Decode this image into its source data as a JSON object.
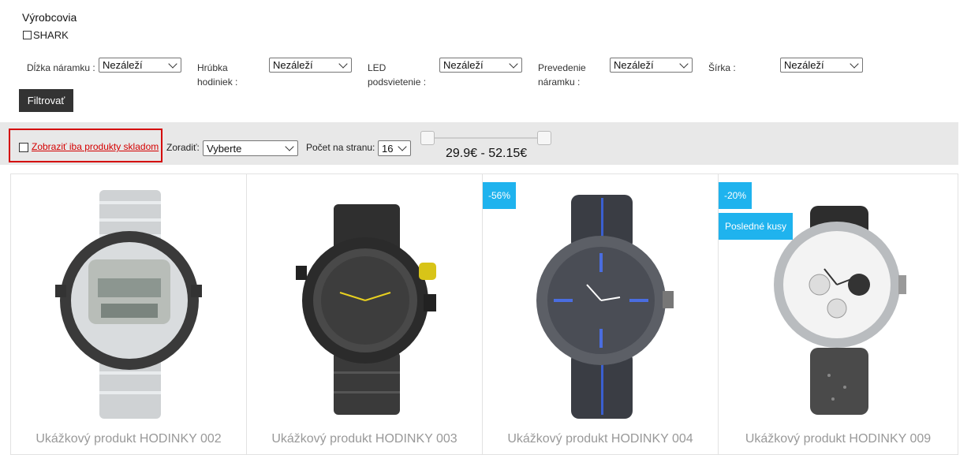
{
  "filters": {
    "brand_title": "Výrobcovia",
    "brand_option": "SHARK",
    "fields": [
      {
        "label_lines": [
          "Dĺžka náramku :"
        ],
        "value": "Nezáleží"
      },
      {
        "label_lines": [
          "Hrúbka",
          "hodiniek :"
        ],
        "value": "Nezáleží"
      },
      {
        "label_lines": [
          "LED",
          "podsvietenie :"
        ],
        "value": "Nezáleží"
      },
      {
        "label_lines": [
          "Prevedenie",
          "náramku :"
        ],
        "value": "Nezáleží"
      },
      {
        "label_lines": [
          "Šírka :"
        ],
        "value": "Nezáleží"
      }
    ],
    "submit_label": "Filtrovať"
  },
  "toolbar": {
    "stock_only_label": "Zobraziť iba produkty skladom",
    "sort_label": "Zoradiť:",
    "sort_value": "Vyberte",
    "per_page_label": "Počet na stranu:",
    "per_page_value": "16",
    "price_range_text": "29.9€ - 52.15€",
    "price_min": 29.9,
    "price_max": 52.15,
    "highlight_color": "#d40000"
  },
  "products": [
    {
      "name": "Ukážkový produkt HODINKY 002",
      "badges": [],
      "icon": "silver-digital-watch-image"
    },
    {
      "name": "Ukážkový produkt HODINKY 003",
      "badges": [],
      "icon": "black-yellow-watch-image"
    },
    {
      "name": "Ukážkový produkt HODINKY 004",
      "badges": [
        "-56%"
      ],
      "icon": "blue-rubber-watch-image"
    },
    {
      "name": "Ukážkový produkt HODINKY 009",
      "badges": [
        "-20%",
        "Posledné kusy"
      ],
      "icon": "white-chronograph-watch-image"
    }
  ],
  "colors": {
    "badge": "#1fb3ee",
    "toolbar_bg": "#e8e8e8",
    "button_bg": "#333333"
  }
}
